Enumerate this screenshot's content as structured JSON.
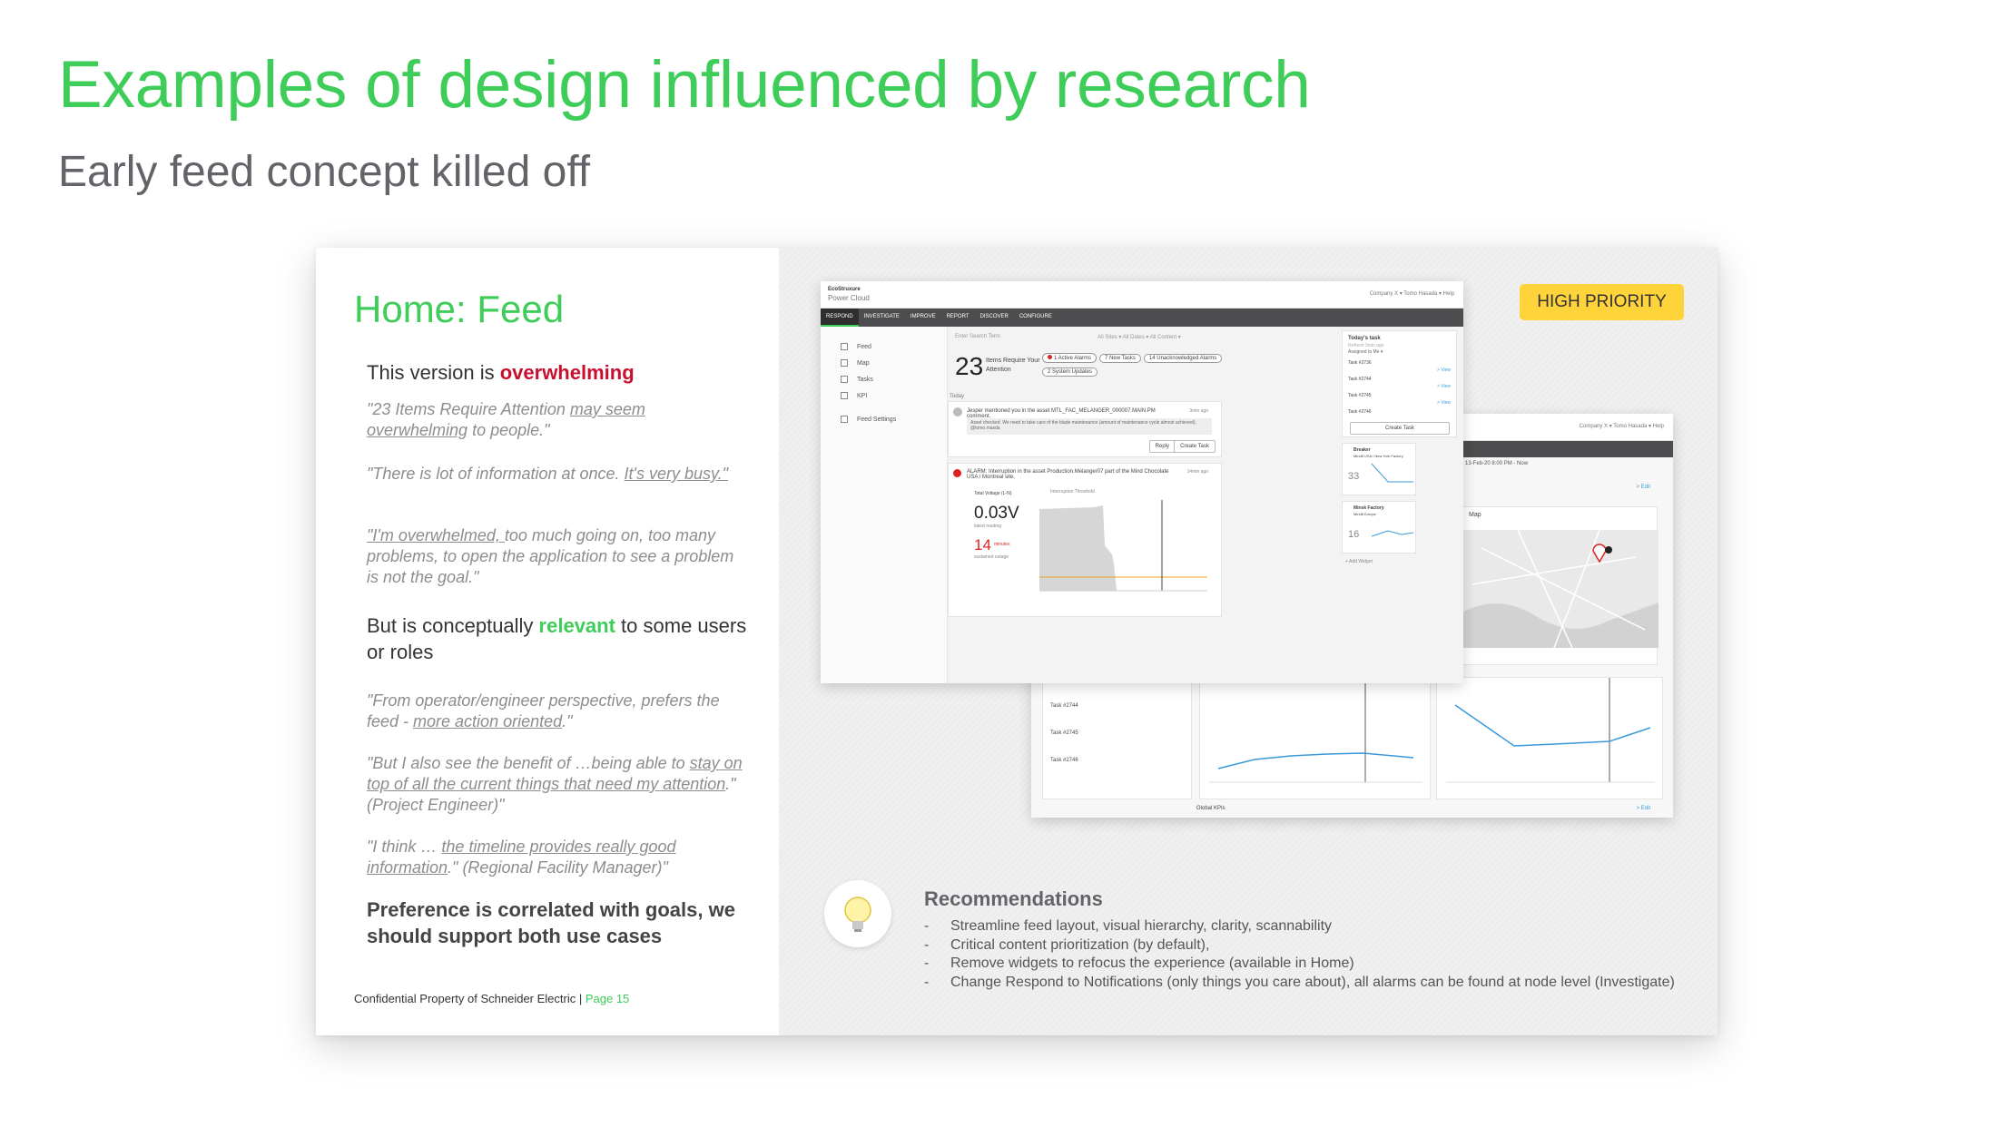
{
  "slide": {
    "title": "Examples of design influenced by research",
    "subtitle": "Early feed concept killed off"
  },
  "left": {
    "heading": "Home: Feed",
    "s1_pre": "This version is ",
    "s1_em": "overwhelming",
    "q1_a": "\"23 Items Require Attention ",
    "q1_u": "may seem overwhelming",
    "q1_b": " to people.\"",
    "q2_a": "\"There is lot of information at once. ",
    "q2_u": "It's very busy.\"",
    "q3_u": "\"I'm overwhelmed, ",
    "q3_b": "too much going on, too many problems, to open the application to see a problem is not the goal.\"",
    "s2_pre": "But is conceptually ",
    "s2_em": "relevant",
    "s2_post": " to some users or roles",
    "q4_a": "\"From operator/engineer perspective, prefers the feed - ",
    "q4_u": "more action oriented",
    "q4_b": ".\"",
    "q5_a": "\"But I also see the benefit of …being able to ",
    "q5_u": "stay on top of all the current things that need my attention",
    "q5_b": ".\" (Project Engineer)\"",
    "q6_a": "\"I think … ",
    "q6_u": "the timeline provides really good information",
    "q6_b": ".\" (Regional Facility Manager)\"",
    "conclusion": "Preference is correlated with goals, we should support both use cases",
    "footer_text": "Confidential Property of Schneider Electric | ",
    "footer_page": "Page 15"
  },
  "badge": "HIGH PRIORITY",
  "mock_front": {
    "logo_brand": "EcoStruxure",
    "logo_product": "Power Cloud",
    "top_right": "Company X ▾     Tomo Hasada ▾     Help",
    "nav": [
      "RESPOND",
      "INVESTIGATE",
      "IMPROVE",
      "REPORT",
      "DISCOVER",
      "CONFIGURE"
    ],
    "side": [
      "Feed",
      "Map",
      "Tasks",
      "KPI",
      "Feed Settings"
    ],
    "search_placeholder": "Enter Search Term",
    "filters": "All Sites ▾     All Dates ▾     All Content ▾",
    "count": "23",
    "count_label": "Items Require Your Attention",
    "pills": [
      "1 Active Alarms",
      "7 New Tasks",
      "14 Unacknowledged Alarms",
      "2 System Updates"
    ],
    "today": "Today",
    "post1": "Jesper mentioned you in the asset MTL_FAC_MELANGER_000007.MAIN.PM comment.",
    "post1_time": "3min ago",
    "post1_body": "Asset checked. We need to take care of the blade maintenance (amount of maintenance cycle almost achieved). @tomo.masda",
    "reply": "Reply",
    "create_task": "Create Task",
    "alarm": "ALARM: Interruption in the asset Production.Melanger07 part of the Mind Chocolate USA / Montreal site.",
    "alarm_time": "14min ago",
    "voltage_label": "Total Voltage (L-N)",
    "voltage": "0.03V",
    "voltage_sub": "latest reading",
    "minutes": "14",
    "minutes_unit": "minutes",
    "minutes_sub": "sustained outage",
    "threshold": "Interruption Threshold",
    "rail_title": "Today's task",
    "rail_sub": "Refresh 3min ago",
    "rail_assigned": "Assigned to Me ▾",
    "tasks": [
      "Task #2736",
      "Task #2744",
      "Task #2745",
      "Task #2746"
    ],
    "view": "> View",
    "rail_create": "Create Task",
    "widget1_title": "Breaker",
    "widget1_sub": "Mind8 USA / New York Factory",
    "widget1_val": "33",
    "widget2_title": "Minsk Factory",
    "widget2_sub": "Mind8 Europe",
    "widget2_val": "16",
    "add_widget": "+ Add Widget"
  },
  "mock_back": {
    "top_right": "Company X ▾     Tomo Hasada ▾     Help",
    "date": "13-Feb-20 8:00 PM - Now",
    "map_label": "Map",
    "edit": "> Edit",
    "global_kpis": "Global KPIs"
  },
  "recommendations": {
    "title": "Recommendations",
    "items": [
      "Streamline feed layout, visual hierarchy, clarity, scannability",
      "Critical content prioritization (by default),",
      "Remove widgets to refocus the experience (available in Home)",
      "Change Respond to Notifications (only things you care about), all alarms can be found at node level (Investigate)"
    ]
  },
  "colors": {
    "accent": "#3dcd58",
    "alert": "#c8102e",
    "badge": "#ffd43b"
  }
}
